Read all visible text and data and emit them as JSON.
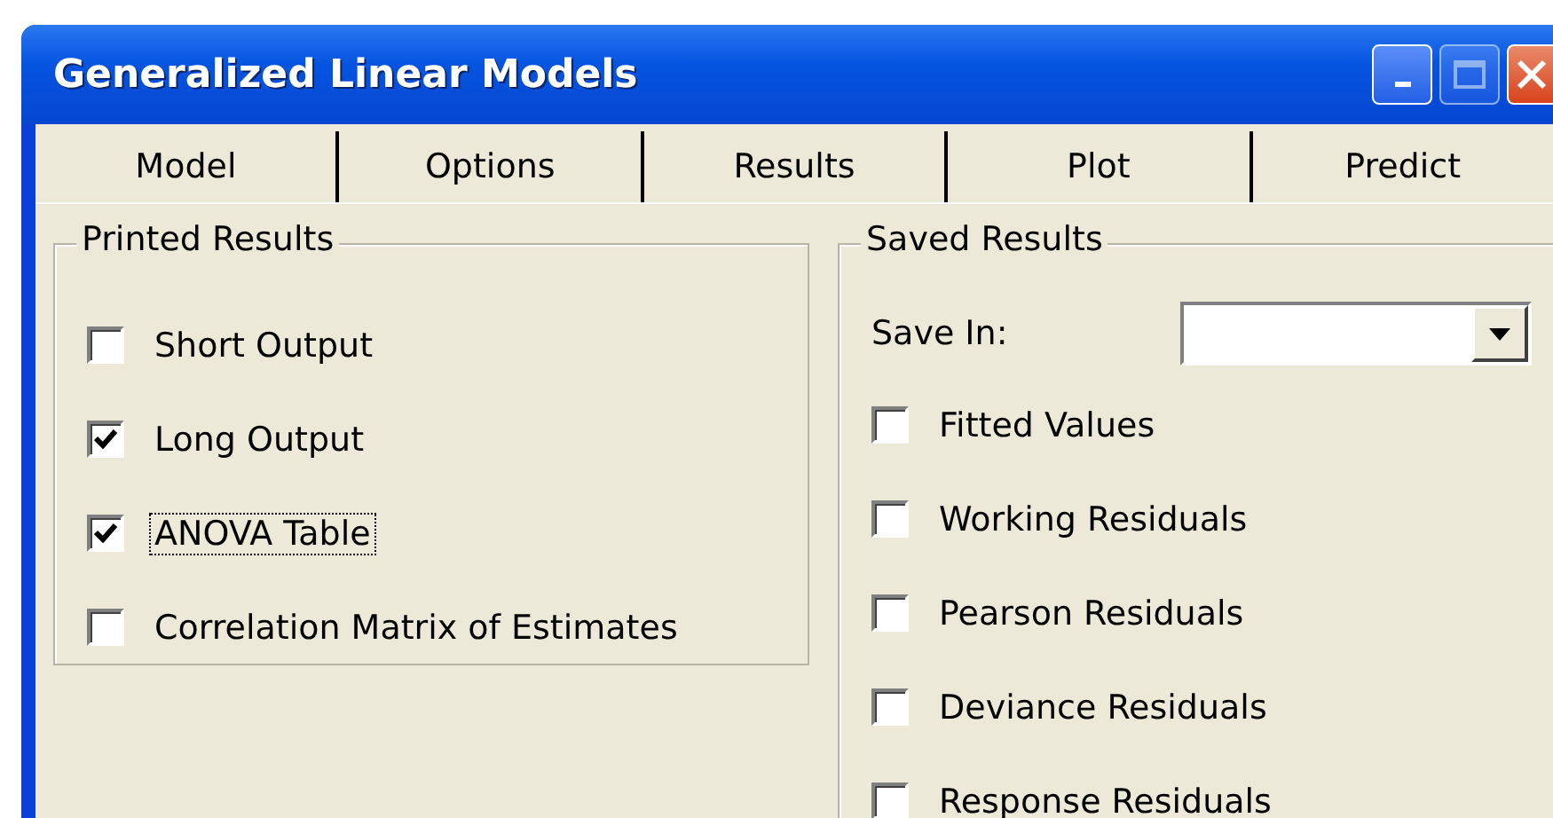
{
  "window": {
    "title": "Generalized Linear Models"
  },
  "tabs": [
    {
      "label": "Model"
    },
    {
      "label": "Options"
    },
    {
      "label": "Results"
    },
    {
      "label": "Plot"
    },
    {
      "label": "Predict"
    }
  ],
  "printed_results": {
    "title": "Printed Results",
    "options": [
      {
        "label": "Short Output",
        "checked": false,
        "focused": false
      },
      {
        "label": "Long Output",
        "checked": true,
        "focused": false
      },
      {
        "label": "ANOVA Table",
        "checked": true,
        "focused": true
      },
      {
        "label": "Correlation Matrix of Estimates",
        "checked": false,
        "focused": false
      }
    ]
  },
  "saved_results": {
    "title": "Saved Results",
    "save_in": {
      "label": "Save In:"
    },
    "options": [
      {
        "label": "Fitted Values",
        "checked": false,
        "focused": false
      },
      {
        "label": "Working Residuals",
        "checked": false,
        "focused": false
      },
      {
        "label": "Pearson Residuals",
        "checked": false,
        "focused": false
      },
      {
        "label": "Deviance Residuals",
        "checked": false,
        "focused": false
      },
      {
        "label": "Response Residuals",
        "checked": false,
        "focused": false
      }
    ]
  }
}
